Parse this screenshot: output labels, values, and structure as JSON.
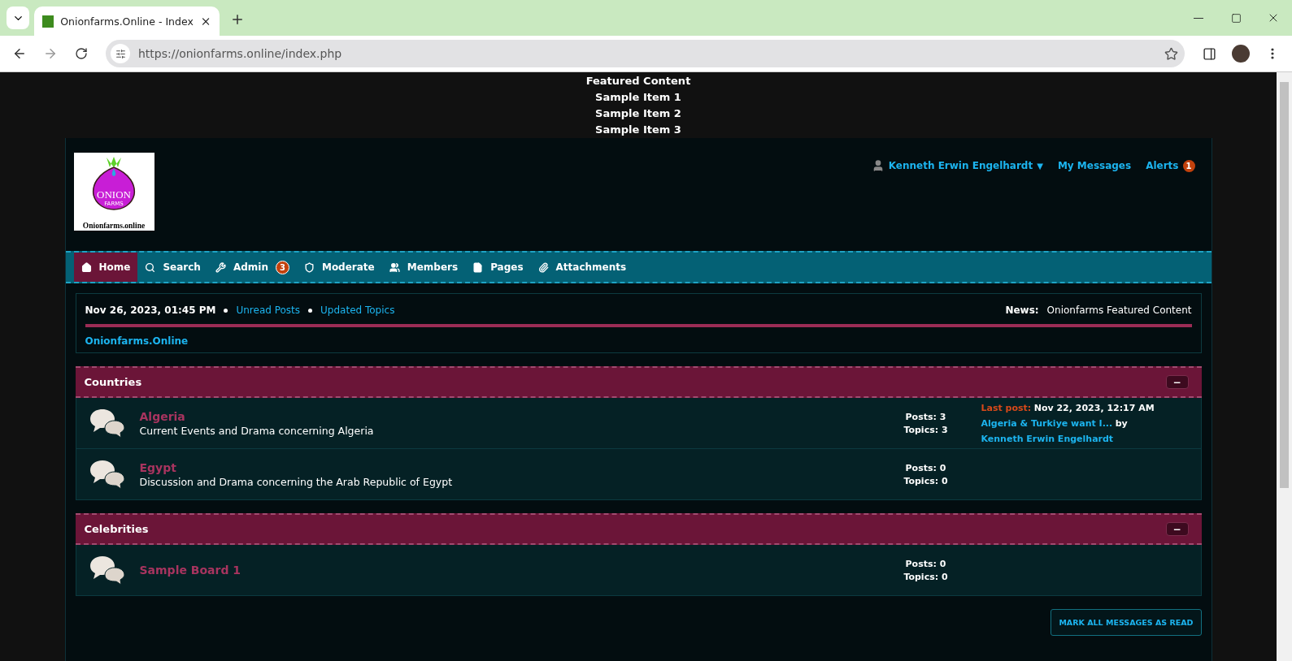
{
  "browser": {
    "tab_title": "Onionfarms.Online - Index",
    "url": "https://onionfarms.online/index.php"
  },
  "featured": {
    "title": "Featured Content",
    "items": [
      "Sample Item 1",
      "Sample Item 2",
      "Sample Item 3"
    ]
  },
  "logo": {
    "name": "ONION",
    "sub": "FARMS",
    "caption": "Onionfarms.online"
  },
  "user_menu": {
    "user": "Kenneth Erwin Engelhardt",
    "caret": "▼",
    "links": [
      {
        "label": "My Messages"
      },
      {
        "label": "Alerts",
        "badge": "1"
      }
    ]
  },
  "nav": [
    {
      "kind": "home",
      "label": "Home",
      "selected": true
    },
    {
      "kind": "search",
      "label": "Search",
      "selected": false
    },
    {
      "kind": "admin",
      "label": "Admin",
      "badge": "3",
      "selected": false
    },
    {
      "kind": "moderate",
      "label": "Moderate",
      "selected": false
    },
    {
      "kind": "members",
      "label": "Members",
      "selected": false
    },
    {
      "kind": "pages",
      "label": "Pages",
      "selected": false
    },
    {
      "kind": "attachments",
      "label": "Attachments",
      "selected": false
    }
  ],
  "info": {
    "date": "Nov 26, 2023, 01:45 PM",
    "links": [
      "Unread Posts",
      "Updated Topics"
    ],
    "news_label": "News:",
    "news_text": "Onionfarms Featured Content",
    "breadcrumb": "Onionfarms.Online"
  },
  "categories": [
    {
      "title": "Countries",
      "collapse": "−",
      "boards": [
        {
          "name": "Algeria",
          "description": "Current Events and Drama concerning Algeria",
          "posts": "Posts: 3",
          "topics": "Topics: 3",
          "last_post": {
            "label": "Last post:",
            "date": "Nov 22, 2023, 12:17 AM",
            "topic": "Algeria & Turkiye want I...",
            "by": "by",
            "author": "Kenneth Erwin Engelhardt"
          }
        },
        {
          "name": "Egypt",
          "description": "Discussion and Drama concerning the Arab Republic of Egypt",
          "posts": "Posts: 0",
          "topics": "Topics: 0"
        }
      ]
    },
    {
      "title": "Celebrities",
      "collapse": "−",
      "boards": [
        {
          "name": "Sample Board 1",
          "posts": "Posts: 0",
          "topics": "Topics: 0"
        }
      ]
    }
  ],
  "mark_read": "MARK ALL MESSAGES AS READ"
}
